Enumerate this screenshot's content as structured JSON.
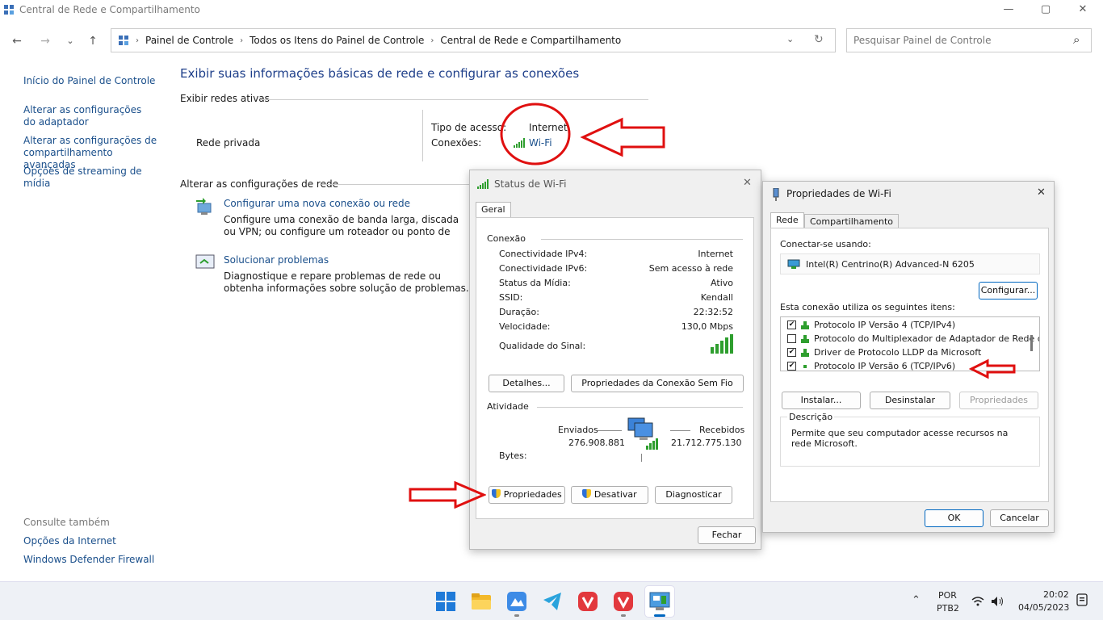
{
  "window": {
    "title": "Central de Rede e Compartilhamento",
    "controls": {
      "minimize": "—",
      "maximize": "▢",
      "close": "✕"
    }
  },
  "nav": {
    "back": "←",
    "forward": "→",
    "recent": "⌄",
    "up": "↑",
    "crumbs": [
      "Painel de Controle",
      "Todos os Itens do Painel de Controle",
      "Central de Rede e Compartilhamento"
    ],
    "crumb_sep": "›",
    "dropdown": "⌄",
    "refresh": "↻",
    "search_placeholder": "Pesquisar Painel de Controle",
    "search_glyph": "⌕"
  },
  "sidebar": {
    "items": [
      "Início do Painel de Controle",
      "Alterar as configurações do adaptador",
      "Alterar as configurações de compartilhamento avançadas",
      "Opções de streaming de mídia"
    ],
    "see_also_title": "Consulte também",
    "see_also": [
      "Opções da Internet",
      "Windows Defender Firewall"
    ]
  },
  "main": {
    "heading": "Exibir suas informações básicas de rede e configurar as conexões",
    "active_networks_title": "Exibir redes ativas",
    "network_name": "Rede privada",
    "access_type_label": "Tipo de acesso:",
    "access_type_value": "Internet",
    "connections_label": "Conexões:",
    "connections_value": "Wi-Fi",
    "change_settings_title": "Alterar as configurações de rede",
    "tasks": [
      {
        "title": "Configurar uma nova conexão ou rede",
        "desc": "Configure uma conexão de banda larga, discada ou VPN; ou configure um roteador ou ponto de acesso."
      },
      {
        "title": "Solucionar problemas",
        "desc": "Diagnostique e repare problemas de rede ou obtenha informações sobre solução de problemas."
      }
    ]
  },
  "status_dialog": {
    "title": "Status de Wi-Fi",
    "close": "✕",
    "tab": "Geral",
    "connection_title": "Conexão",
    "rows": [
      {
        "label": "Conectividade IPv4:",
        "value": "Internet"
      },
      {
        "label": "Conectividade IPv6:",
        "value": "Sem acesso à rede"
      },
      {
        "label": "Status da Mídia:",
        "value": "Ativo"
      },
      {
        "label": "SSID:",
        "value": "Kendall"
      },
      {
        "label": "Duração:",
        "value": "22:32:52"
      },
      {
        "label": "Velocidade:",
        "value": "130,0 Mbps"
      }
    ],
    "signal_label": "Qualidade do Sinal:",
    "details_btn": "Detalhes...",
    "wireless_props_btn": "Propriedades da Conexão Sem Fio",
    "activity_title": "Atividade",
    "sent_label": "Enviados",
    "received_label": "Recebidos",
    "bytes_label": "Bytes:",
    "sent_value": "276.908.881",
    "received_value": "21.712.775.130",
    "properties_btn": "Propriedades",
    "disable_btn": "Desativar",
    "diagnose_btn": "Diagnosticar",
    "close_btn": "Fechar"
  },
  "props_dialog": {
    "title": "Propriedades de Wi-Fi",
    "close": "✕",
    "tabs": [
      "Rede",
      "Compartilhamento"
    ],
    "connect_using_label": "Conectar-se usando:",
    "adapter": "Intel(R) Centrino(R) Advanced-N 6205",
    "configure_btn": "Configurar...",
    "items_label": "Esta conexão utiliza os seguintes itens:",
    "items": [
      {
        "label": "Protocolo IP Versão 4 (TCP/IPv4)",
        "checked": "✔"
      },
      {
        "label": "Protocolo do Multiplexador de Adaptador de Rede da M",
        "checked": ""
      },
      {
        "label": "Driver de Protocolo LLDP da Microsoft",
        "checked": "✔"
      },
      {
        "label": "Protocolo IP Versão 6 (TCP/IPv6)",
        "checked": "✔"
      }
    ],
    "install_btn": "Instalar...",
    "uninstall_btn": "Desinstalar",
    "properties_btn": "Propriedades",
    "description_title": "Descrição",
    "description": "Permite que seu computador acesse recursos na rede Microsoft.",
    "ok_btn": "OK",
    "cancel_btn": "Cancelar"
  },
  "taskbar": {
    "tray_chevron": "⌃",
    "lang_top": "POR",
    "lang_bottom": "PTB2",
    "time": "20:02",
    "date": "04/05/2023"
  },
  "colors": {
    "accent": "#0067c0",
    "link": "#1a4f8b",
    "heading": "#1e3f8a",
    "annotation": "#e01010",
    "signal": "#2e9e2e"
  }
}
